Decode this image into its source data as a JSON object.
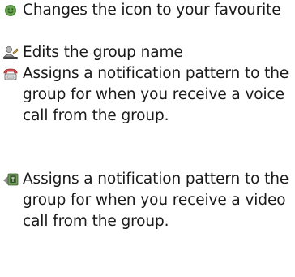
{
  "items": [
    {
      "icon": "smiley-face-icon",
      "text": "Changes the icon to your favourite"
    },
    {
      "icon": "user-edit-icon",
      "text": "Edits the group name"
    },
    {
      "icon": "phone-icon",
      "text": "Assigns a notification pattern to the group for when you receive a voice call from the group."
    },
    {
      "icon": "video-call-icon",
      "text": "Assigns a notification pattern to the group for when you receive a video call from the group."
    }
  ],
  "colors": {
    "text": "#1a1a1a",
    "icon_green": "#4f8a3c",
    "icon_gray": "#8a8a8a",
    "icon_dark": "#3c3c3c",
    "icon_red": "#d94c4c"
  }
}
